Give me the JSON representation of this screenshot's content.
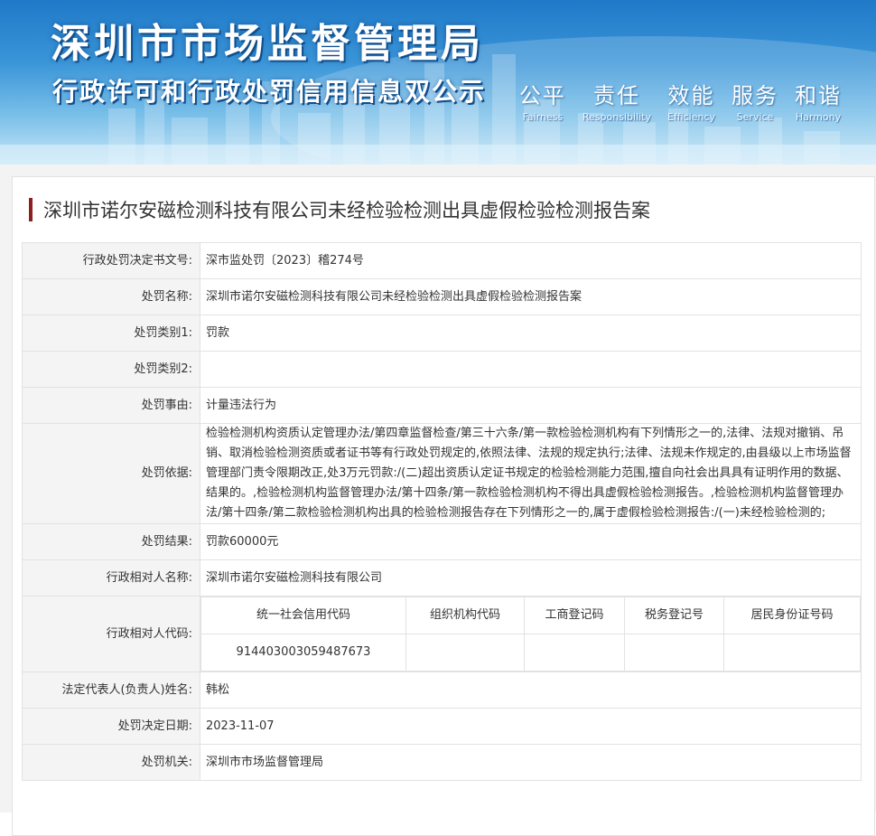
{
  "banner": {
    "title": "深圳市市场监督管理局",
    "subtitle": "行政许可和行政处罚信用信息双公示",
    "slogans": [
      {
        "zh": "公平",
        "en": "Fairness"
      },
      {
        "zh": "责任",
        "en": "Responsibility"
      },
      {
        "zh": "效能",
        "en": "Efficiency"
      },
      {
        "zh": "服务",
        "en": "Service"
      },
      {
        "zh": "和谐",
        "en": "Harmony"
      }
    ]
  },
  "case_title": "深圳市诺尔安磁检测科技有限公司未经检验检测出具虚假检验检测报告案",
  "rows": {
    "decision_no": {
      "label": "行政处罚决定书文号:",
      "value": "深市监处罚〔2023〕稽274号"
    },
    "penalty_name": {
      "label": "处罚名称:",
      "value": "深圳市诺尔安磁检测科技有限公司未经检验检测出具虚假检验检测报告案"
    },
    "category1": {
      "label": "处罚类别1:",
      "value": "罚款"
    },
    "category2": {
      "label": "处罚类别2:",
      "value": ""
    },
    "reason": {
      "label": "处罚事由:",
      "value": "计量违法行为"
    },
    "basis": {
      "label": "处罚依据:",
      "value": "检验检测机构资质认定管理办法/第四章监督检查/第三十六条/第一款检验检测机构有下列情形之一的,法律、法规对撤销、吊销、取消检验检测资质或者证书等有行政处罚规定的,依照法律、法规的规定执行;法律、法规未作规定的,由县级以上市场监督管理部门责令限期改正,处3万元罚款:/(二)超出资质认定证书规定的检验检测能力范围,擅自向社会出具具有证明作用的数据、结果的。,检验检测机构监督管理办法/第十四条/第一款检验检测机构不得出具虚假检验检测报告。,检验检测机构监督管理办法/第十四条/第二款检验检测机构出具的检验检测报告存在下列情形之一的,属于虚假检验检测报告:/(一)未经检验检测的;"
    },
    "result": {
      "label": "处罚结果:",
      "value": "罚款60000元"
    },
    "party_name": {
      "label": "行政相对人名称:",
      "value": "深圳市诺尔安磁检测科技有限公司"
    },
    "party_code": {
      "label": "行政相对人代码:",
      "headers": [
        "统一社会信用代码",
        "组织机构代码",
        "工商登记码",
        "税务登记号",
        "居民身份证号码"
      ],
      "values": [
        "914403003059487673",
        "",
        "",
        "",
        ""
      ]
    },
    "legal_rep": {
      "label": "法定代表人(负责人)姓名:",
      "value": "韩松"
    },
    "decision_date": {
      "label": "处罚决定日期:",
      "value": "2023-11-07"
    },
    "authority": {
      "label": "处罚机关:",
      "value": "深圳市市场监督管理局"
    }
  },
  "colors": {
    "title_bar": "#8c1f1f",
    "banner_blue": "#1f79c8",
    "label_bg": "#f4f4f4"
  }
}
